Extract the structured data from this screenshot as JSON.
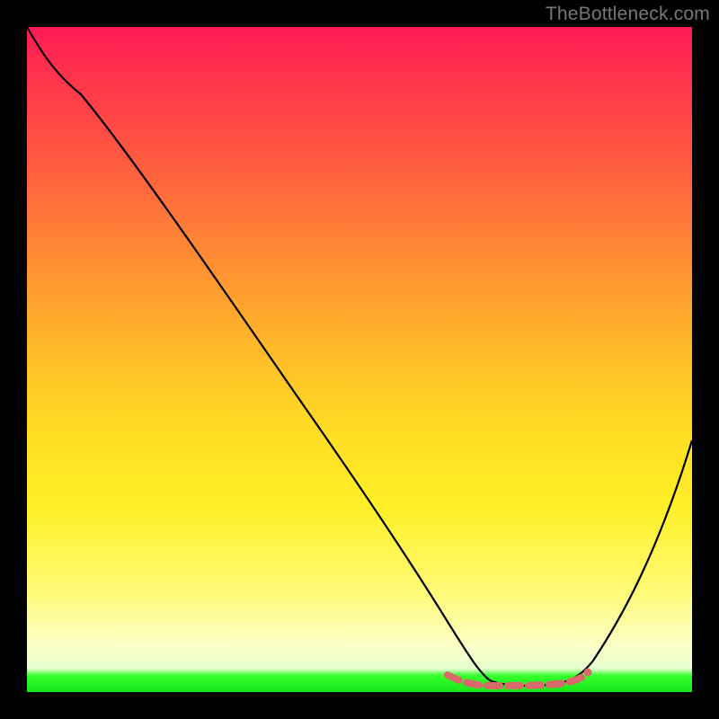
{
  "watermark": "TheBottleneck.com",
  "chart_data": {
    "type": "line",
    "title": "",
    "xlabel": "",
    "ylabel": "",
    "xlim": [
      0,
      100
    ],
    "ylim": [
      0,
      100
    ],
    "grid": false,
    "series": [
      {
        "name": "curve",
        "color": "#000000",
        "x": [
          0,
          3,
          8,
          15,
          25,
          35,
          45,
          55,
          60,
          63,
          66,
          70,
          74,
          78,
          82,
          85,
          90,
          95,
          100
        ],
        "y": [
          100,
          96,
          90,
          80,
          65,
          50,
          35,
          20,
          11,
          6,
          2.5,
          1.2,
          1.0,
          1.0,
          1.5,
          3,
          10,
          22,
          38
        ]
      },
      {
        "name": "bottom-marker-segment",
        "color": "#e06666",
        "style": "dashed-thick",
        "x": [
          63,
          66,
          70,
          74,
          78,
          82
        ],
        "y": [
          1.5,
          1.2,
          1.0,
          1.0,
          1.2,
          1.8
        ]
      }
    ]
  }
}
